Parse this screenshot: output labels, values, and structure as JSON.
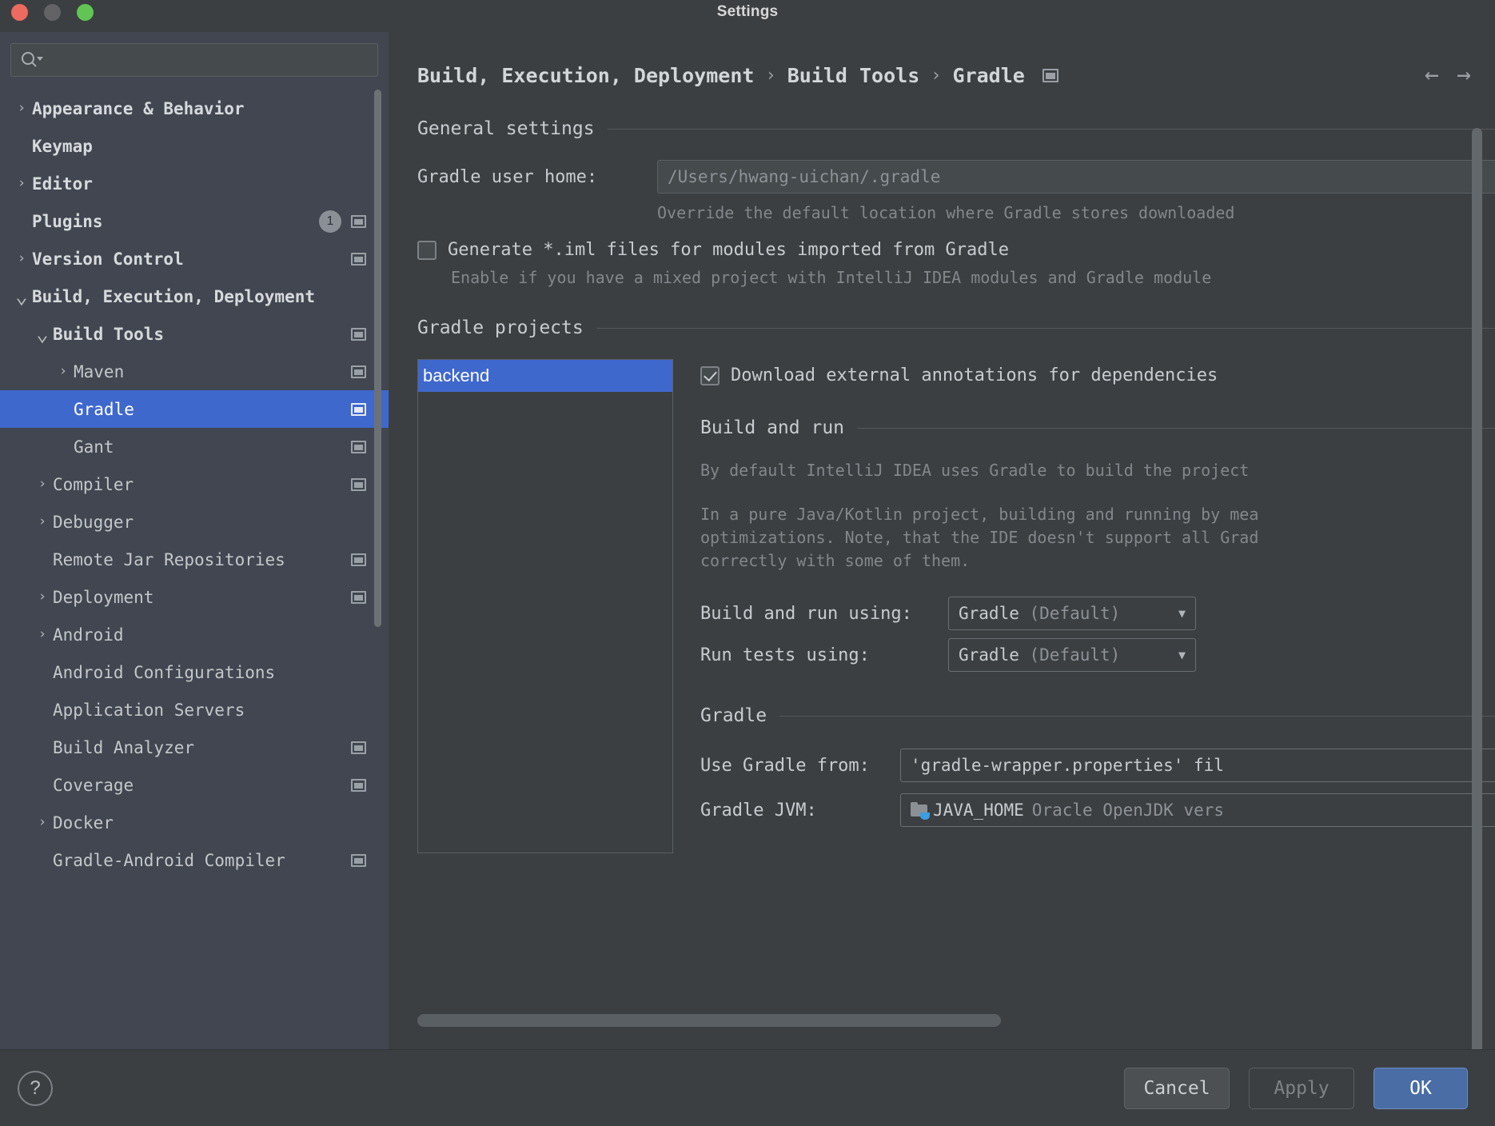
{
  "window": {
    "title": "Settings",
    "traffic_lights": [
      "close",
      "minimize",
      "zoom"
    ]
  },
  "sidebar": {
    "search": {
      "placeholder": "",
      "value": "",
      "icon": "search-icon"
    },
    "help_button": "?",
    "scrollbar": {
      "orientation": "vertical"
    },
    "items": [
      {
        "label": "Appearance & Behavior",
        "arrow": "collapsed",
        "indent": 0,
        "bold": true,
        "badge": null,
        "project_icon": false
      },
      {
        "label": "Keymap",
        "arrow": "none",
        "indent": 0,
        "bold": true,
        "badge": null,
        "project_icon": false
      },
      {
        "label": "Editor",
        "arrow": "collapsed",
        "indent": 0,
        "bold": true,
        "badge": null,
        "project_icon": false
      },
      {
        "label": "Plugins",
        "arrow": "none",
        "indent": 0,
        "bold": true,
        "badge": "1",
        "project_icon": true
      },
      {
        "label": "Version Control",
        "arrow": "collapsed",
        "indent": 0,
        "bold": true,
        "badge": null,
        "project_icon": true
      },
      {
        "label": "Build, Execution, Deployment",
        "arrow": "expanded",
        "indent": 0,
        "bold": true,
        "badge": null,
        "project_icon": false
      },
      {
        "label": "Build Tools",
        "arrow": "expanded",
        "indent": 1,
        "bold": true,
        "badge": null,
        "project_icon": true
      },
      {
        "label": "Maven",
        "arrow": "collapsed",
        "indent": 2,
        "bold": false,
        "badge": null,
        "project_icon": true
      },
      {
        "label": "Gradle",
        "arrow": "none",
        "indent": 2,
        "bold": false,
        "badge": null,
        "project_icon": true,
        "selected": true
      },
      {
        "label": "Gant",
        "arrow": "none",
        "indent": 2,
        "bold": false,
        "badge": null,
        "project_icon": true
      },
      {
        "label": "Compiler",
        "arrow": "collapsed",
        "indent": 1,
        "bold": false,
        "badge": null,
        "project_icon": true
      },
      {
        "label": "Debugger",
        "arrow": "collapsed",
        "indent": 1,
        "bold": false,
        "badge": null,
        "project_icon": false
      },
      {
        "label": "Remote Jar Repositories",
        "arrow": "none",
        "indent": 1,
        "bold": false,
        "badge": null,
        "project_icon": true
      },
      {
        "label": "Deployment",
        "arrow": "collapsed",
        "indent": 1,
        "bold": false,
        "badge": null,
        "project_icon": true
      },
      {
        "label": "Android",
        "arrow": "collapsed",
        "indent": 1,
        "bold": false,
        "badge": null,
        "project_icon": false
      },
      {
        "label": "Android Configurations",
        "arrow": "none",
        "indent": 1,
        "bold": false,
        "badge": null,
        "project_icon": false
      },
      {
        "label": "Application Servers",
        "arrow": "none",
        "indent": 1,
        "bold": false,
        "badge": null,
        "project_icon": false
      },
      {
        "label": "Build Analyzer",
        "arrow": "none",
        "indent": 1,
        "bold": false,
        "badge": null,
        "project_icon": true
      },
      {
        "label": "Coverage",
        "arrow": "none",
        "indent": 1,
        "bold": false,
        "badge": null,
        "project_icon": true
      },
      {
        "label": "Docker",
        "arrow": "collapsed",
        "indent": 1,
        "bold": false,
        "badge": null,
        "project_icon": false
      },
      {
        "label": "Gradle-Android Compiler",
        "arrow": "none",
        "indent": 1,
        "bold": false,
        "badge": null,
        "project_icon": true
      }
    ]
  },
  "breadcrumb": {
    "items": [
      "Build, Execution, Deployment",
      "Build Tools",
      "Gradle"
    ],
    "separator": "›",
    "project_icon": "project-scope-icon",
    "back_arrow": "←",
    "forward_arrow": "→"
  },
  "general_settings": {
    "section_title": "General settings",
    "gradle_user_home_label": "Gradle user home:",
    "gradle_user_home_value": "/Users/hwang-uichan/.gradle",
    "gradle_user_home_hint": "Override the default location where Gradle stores downloaded",
    "generate_iml_label": "Generate *.iml files for modules imported from Gradle",
    "generate_iml_checked": false,
    "generate_iml_hint": "Enable if you have a mixed project with IntelliJ IDEA modules and Gradle module"
  },
  "gradle_projects": {
    "section_title": "Gradle projects",
    "list": [
      {
        "label": "backend",
        "selected": true
      }
    ],
    "download_annotations_label": "Download external annotations for dependencies",
    "download_annotations_checked": true,
    "build_and_run": {
      "section_title": "Build and run",
      "paragraph_1": "By default IntelliJ IDEA uses Gradle to build the project",
      "paragraph_2_line_1": "In a pure Java/Kotlin project, building and running by mea",
      "paragraph_2_line_2": "optimizations. Note, that the IDE doesn't support all Grad",
      "paragraph_2_line_3": "correctly with some of them.",
      "build_and_run_using_label": "Build and run using:",
      "build_and_run_using_value": "Gradle",
      "build_and_run_using_value_dim": "(Default)",
      "run_tests_using_label": "Run tests using:",
      "run_tests_using_value": "Gradle",
      "run_tests_using_value_dim": "(Default)"
    },
    "gradle": {
      "section_title": "Gradle",
      "use_gradle_from_label": "Use Gradle from:",
      "use_gradle_from_value": "'gradle-wrapper.properties' fil",
      "gradle_jvm_label": "Gradle JVM:",
      "gradle_jvm_value": "JAVA_HOME",
      "gradle_jvm_value_dim": "Oracle OpenJDK vers",
      "gradle_jvm_icon": "jdk-folder-icon"
    }
  },
  "footer": {
    "cancel_label": "Cancel",
    "apply_label": "Apply",
    "ok_label": "OK"
  },
  "colors": {
    "selection_blue": "#3f68cd",
    "ok_button_blue": "#4a6da6",
    "sidebar_bg": "#414650",
    "panel_bg": "#3c3f41",
    "text_primary": "#c8ccd0",
    "text_dim": "#83878b"
  }
}
